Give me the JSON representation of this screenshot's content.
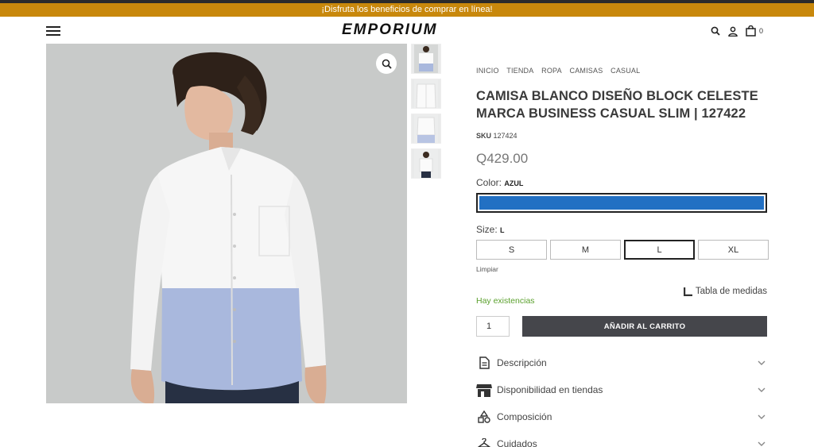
{
  "promo": {
    "text": "¡Disfruta los beneficios de comprar en línea!"
  },
  "header": {
    "logo": "EMPORIUM",
    "cart_count": "0"
  },
  "breadcrumb": [
    "INICIO",
    "TIENDA",
    "ROPA",
    "CAMISAS",
    "CASUAL"
  ],
  "product": {
    "title_line1": "CAMISA BLANCO DISEÑO BLOCK CELESTE",
    "title_line2": "MARCA BUSINESS CASUAL SLIM | 127422",
    "sku_label": "SKU",
    "sku_value": "127424",
    "price": "Q429.00",
    "color_label": "Color:",
    "color_value": "AZUL",
    "color_swatch": "#2270c3",
    "size_label": "Size:",
    "size_value": "L",
    "sizes": [
      "S",
      "M",
      "L",
      "XL"
    ],
    "selected_size": "L",
    "clear_label": "Limpiar",
    "size_chart_label": "Tabla de medidas",
    "stock_text": "Hay existencias",
    "stock_color": "#5aa02c",
    "quantity": "1",
    "add_to_cart": "AÑADIR AL CARRITO"
  },
  "accordion": [
    {
      "label": "Descripción",
      "icon": "document-icon"
    },
    {
      "label": "Disponibilidad en tiendas",
      "icon": "store-icon"
    },
    {
      "label": "Composición",
      "icon": "shapes-icon"
    },
    {
      "label": "Cuidados",
      "icon": "hanger-icon"
    }
  ],
  "colors": {
    "promo_bar": "#c8880c",
    "button_dark": "#45464b"
  }
}
